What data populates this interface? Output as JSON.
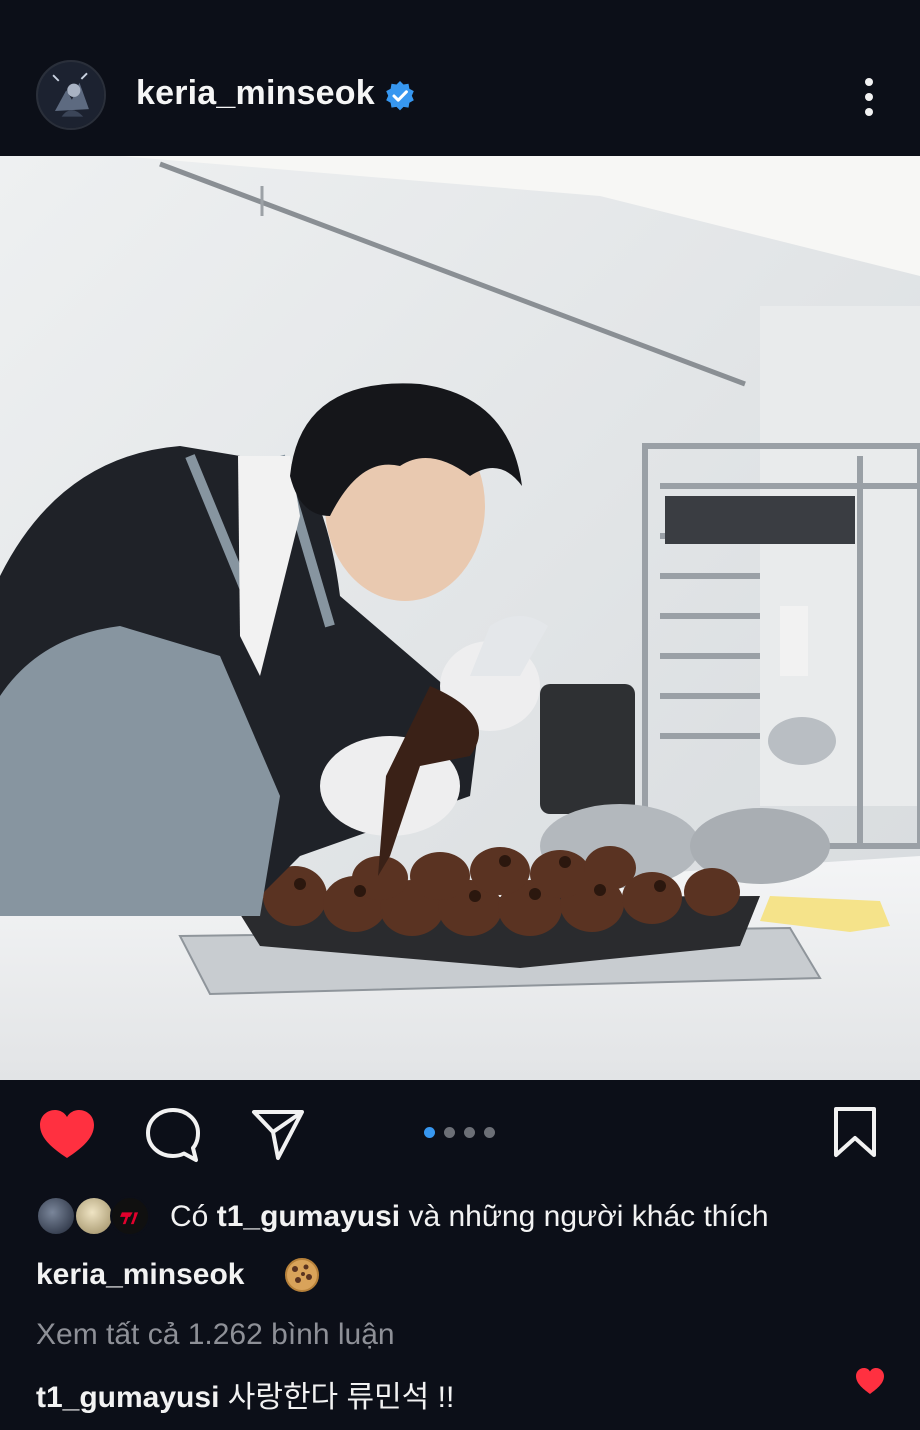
{
  "post": {
    "username": "keria_minseok",
    "verified": true,
    "more_icon": "more-vertical-icon"
  },
  "actions": {
    "like_icon": "heart-filled-icon",
    "comment_icon": "comment-icon",
    "share_icon": "send-icon",
    "save_icon": "bookmark-icon",
    "carousel": {
      "count": 4,
      "active_index": 0
    }
  },
  "likes": {
    "prefix": "Có",
    "user": "t1_gumayusi",
    "suffix": "và những người khác thích"
  },
  "caption": {
    "username": "keria_minseok",
    "emoji_icon": "cookie-icon"
  },
  "comments": {
    "view_all": "Xem tất cả 1.262 bình luận",
    "top": {
      "user": "t1_gumayusi",
      "text": "사랑한다 류민석 !!"
    }
  },
  "colors": {
    "background": "#0c0f18",
    "like_red": "#ff3040",
    "accent_blue": "#3797f0",
    "muted_text": "#8e9097"
  }
}
